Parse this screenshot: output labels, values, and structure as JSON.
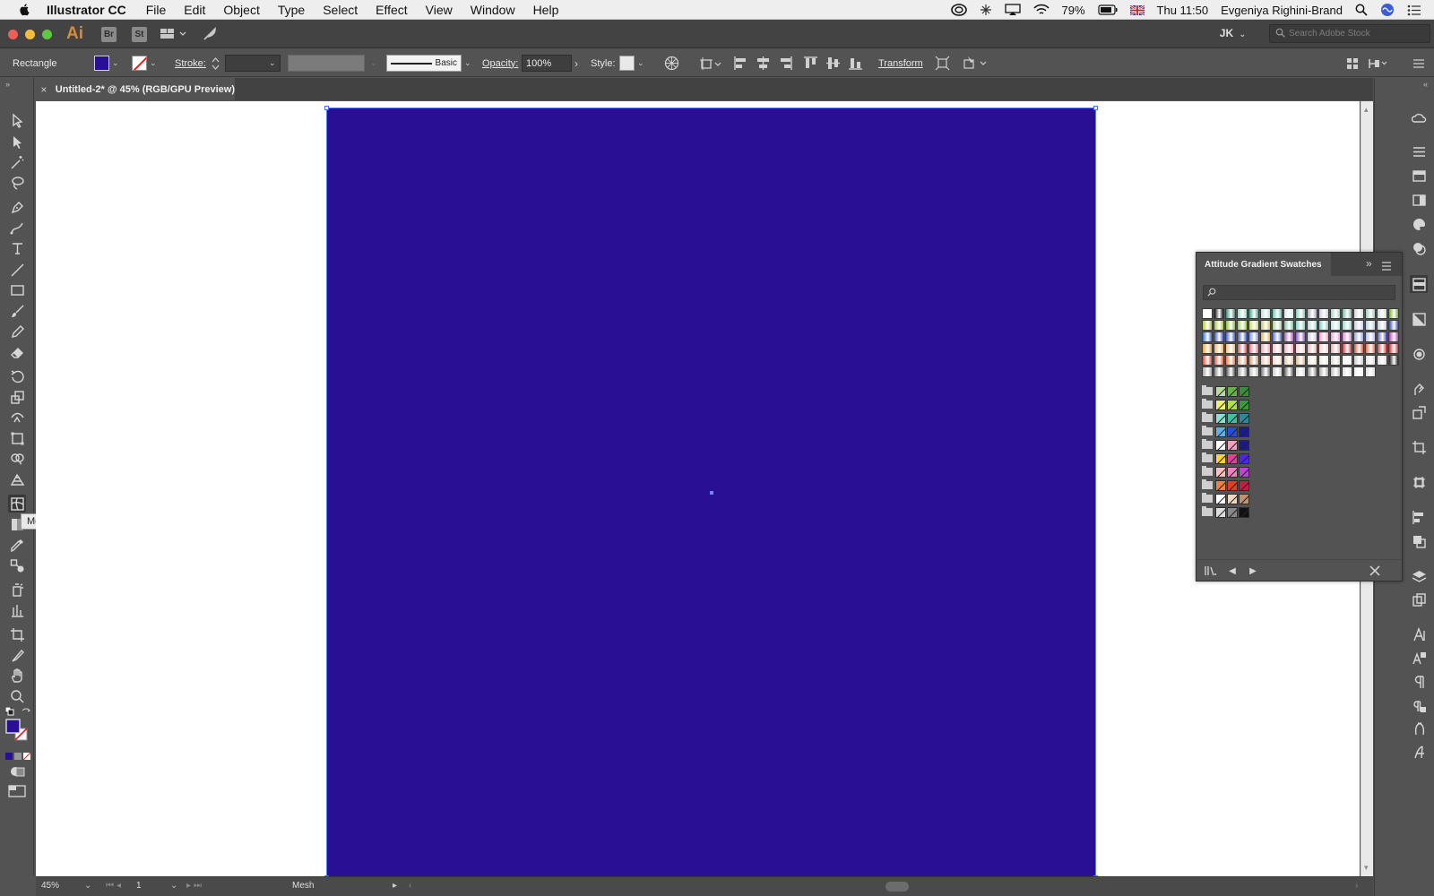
{
  "menubar": {
    "app_name": "Illustrator CC",
    "items": [
      "File",
      "Edit",
      "Object",
      "Type",
      "Select",
      "Effect",
      "View",
      "Window",
      "Help"
    ],
    "battery": "79%",
    "clock": "Thu 11:50",
    "user": "Evgeniya Righini-Brand"
  },
  "appbar": {
    "logo": "Ai",
    "bridge": "Br",
    "stock": "St",
    "workspace": "JK",
    "search_placeholder": "Search Adobe Stock"
  },
  "controlbar": {
    "object_type": "Rectangle",
    "stroke_label": "Stroke:",
    "brush_label": "Basic",
    "opacity_label": "Opacity:",
    "opacity_value": "100%",
    "style_label": "Style:",
    "transform_label": "Transform"
  },
  "document": {
    "tab_title": "Untitled-2* @ 45% (RGB/GPU Preview)"
  },
  "toolbox": {
    "tooltip": "Mesh Tool (U)"
  },
  "statusbar": {
    "zoom": "45%",
    "artboard": "1",
    "tool_name": "Mesh"
  },
  "swatches_panel": {
    "title": "Attitude Gradient Swatches",
    "search_placeholder": ""
  },
  "colors": {
    "fill": "#290f94",
    "accent": "#d68b36"
  }
}
